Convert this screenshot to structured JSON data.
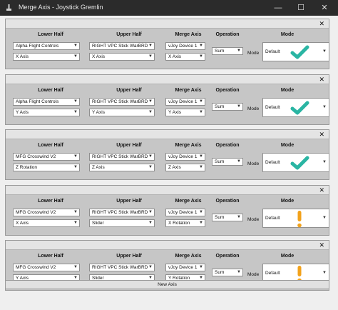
{
  "window": {
    "title": "Merge Axis - Joystick Gremlin",
    "minimize_glyph": "—",
    "maximize_glyph": "☐",
    "close_glyph": "✕"
  },
  "headers": {
    "lower": "Lower Half",
    "upper": "Upper Half",
    "merge": "Merge Axis",
    "operation": "Operation",
    "mode": "Mode",
    "mode_label": "Mode"
  },
  "panels": [
    {
      "close_glyph": "✕",
      "lower_device": "Alpha Flight Controls",
      "lower_axis": "X Axis",
      "upper_device": "RIGHT VPC Stick WarBRD",
      "upper_axis": "X Axis",
      "merge_device": "vJoy Device 1",
      "merge_axis": "X Axis",
      "operation": "Sum",
      "mode": "Default",
      "status_icon": "check-icon"
    },
    {
      "close_glyph": "✕",
      "lower_device": "Alpha Flight Controls",
      "lower_axis": "Y Axis",
      "upper_device": "RIGHT VPC Stick WarBRD",
      "upper_axis": "Y Axis",
      "merge_device": "vJoy Device 1",
      "merge_axis": "Y Axis",
      "operation": "Sum",
      "mode": "Default",
      "status_icon": "check-icon"
    },
    {
      "close_glyph": "✕",
      "lower_device": "MFG Crosswind V2",
      "lower_axis": "Z Rotation",
      "upper_device": "RIGHT VPC Stick WarBRD",
      "upper_axis": "Z Axis",
      "merge_device": "vJoy Device 1",
      "merge_axis": "Z Axis",
      "operation": "Sum",
      "mode": "Default",
      "status_icon": "check-icon"
    },
    {
      "close_glyph": "✕",
      "lower_device": "MFG Crosswind V2",
      "lower_axis": "X Axis",
      "upper_device": "RIGHT VPC Stick WarBRD",
      "upper_axis": "Slider",
      "merge_device": "vJoy Device 1",
      "merge_axis": "X Rotation",
      "operation": "Sum",
      "mode": "Default",
      "status_icon": "warning-icon"
    },
    {
      "close_glyph": "✕",
      "lower_device": "MFG Crosswind V2",
      "lower_axis": "Y Axis",
      "upper_device": "RIGHT VPC Stick WarBRD",
      "upper_axis": "Slider",
      "merge_device": "vJoy Device 1",
      "merge_axis": "Y Rotation",
      "operation": "Sum",
      "mode": "Default",
      "status_icon": "warning-icon"
    }
  ],
  "new_axis_button": "New Axis",
  "colors": {
    "check": "#2ab5a3",
    "warning": "#f2a21b",
    "titlebar": "#2b2b2b"
  }
}
